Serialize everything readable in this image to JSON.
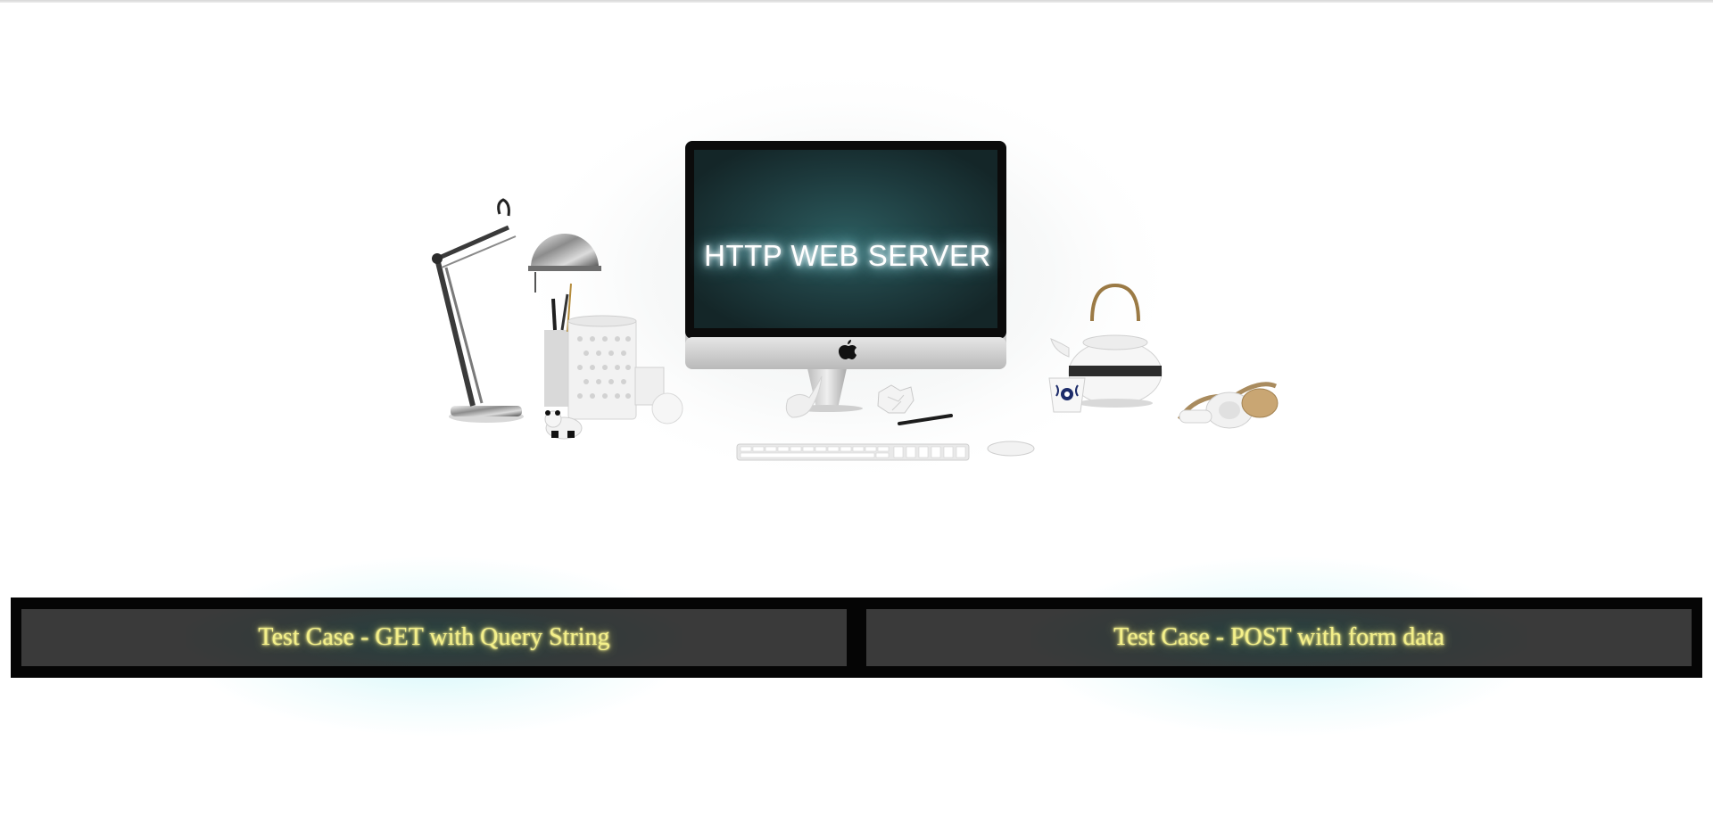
{
  "hero": {
    "screen_title": "HTTP WEB SERVER",
    "image_alt": "desk-with-monitor-illustration"
  },
  "nav": {
    "items": [
      {
        "label": "Test Case - GET with Query String"
      },
      {
        "label": "Test Case - POST with form data"
      }
    ]
  },
  "colors": {
    "background": "#ffffff",
    "nav_frame": "#050505",
    "nav_item_bg": "#3a3a3a",
    "nav_text": "#f4f08a",
    "screen_glow": "#79d9e8"
  },
  "icons": [
    "apple-logo-icon"
  ]
}
